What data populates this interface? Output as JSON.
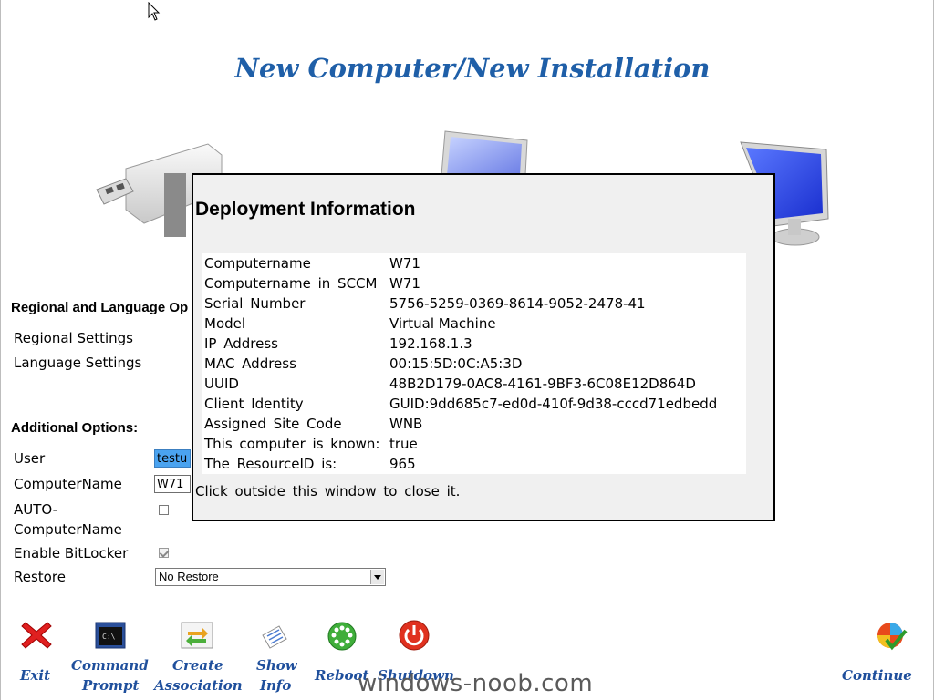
{
  "page": {
    "title": "New Computer/New Installation",
    "watermark": "windows-noob.com"
  },
  "regional": {
    "heading": "Regional and Language Op",
    "regional_settings_label": "Regional Settings",
    "language_settings_label": "Language Settings"
  },
  "additional": {
    "heading": "Additional Options:",
    "user_label": "User",
    "user_value": "testu",
    "computername_label": "ComputerName",
    "computername_value": "W71",
    "auto_label_1": "AUTO-",
    "auto_label_2": "ComputerName",
    "auto_checked": false,
    "bitlocker_label": "Enable BitLocker",
    "bitlocker_checked": true,
    "restore_label": "Restore",
    "restore_value": "No Restore"
  },
  "toolbar": {
    "exit": "Exit",
    "command_1": "Command",
    "command_2": "Prompt",
    "create_1": "Create",
    "create_2": "Association",
    "show_1": "Show",
    "show_2": "Info",
    "reboot": "Reboot",
    "shutdown": "Shutdown",
    "continue": "Continue"
  },
  "modal": {
    "title": "Deployment Information",
    "footer": "Click outside this window to close it.",
    "rows": [
      {
        "key": "Computername",
        "value": "W71"
      },
      {
        "key": "Computername in SCCM",
        "value": "W71"
      },
      {
        "key": "Serial Number",
        "value": "5756-5259-0369-8614-9052-2478-41"
      },
      {
        "key": "Model",
        "value": "Virtual Machine"
      },
      {
        "key": "IP Address",
        "value": "192.168.1.3"
      },
      {
        "key": "MAC Address",
        "value": "00:15:5D:0C:A5:3D"
      },
      {
        "key": "UUID",
        "value": "48B2D179-0AC8-4161-9BF3-6C08E12D864D"
      },
      {
        "key": "Client Identity",
        "value": "GUID:9dd685c7-ed0d-410f-9d38-cccd71edbedd"
      },
      {
        "key": "Assigned Site Code",
        "value": "WNB"
      },
      {
        "key": "This computer is known:",
        "value": "true"
      },
      {
        "key": "The ResourceID is:",
        "value": "965"
      }
    ]
  },
  "colors": {
    "title": "#1f5fa8",
    "toolbar_label": "#1f4f9c",
    "highlight": "#4aa3f0"
  },
  "icons": [
    "mouse-cursor-icon",
    "usb-drive-icon",
    "monitor-icon",
    "computer-icon",
    "exit-icon",
    "command-prompt-icon",
    "create-association-icon",
    "show-info-icon",
    "reboot-icon",
    "shutdown-icon",
    "continue-icon"
  ]
}
